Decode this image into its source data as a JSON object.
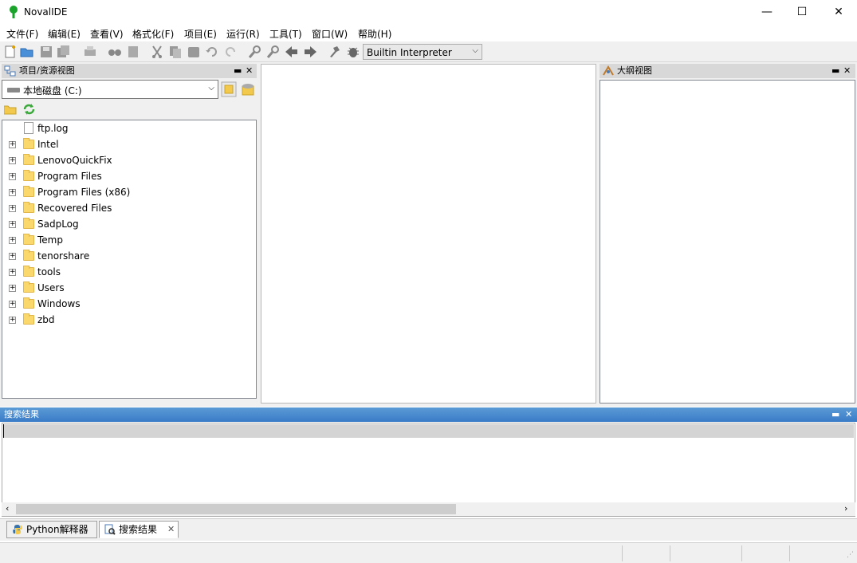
{
  "window": {
    "title": "NovalIDE",
    "minimize": "—",
    "maximize": "☐",
    "close": "✕"
  },
  "menu": [
    "文件(F)",
    "编辑(E)",
    "查看(V)",
    "格式化(F)",
    "项目(E)",
    "运行(R)",
    "工具(T)",
    "窗口(W)",
    "帮助(H)"
  ],
  "toolbar": {
    "interpreter_value": "Builtin Interpreter",
    "icons": [
      "new-file-icon",
      "open-folder-icon",
      "save-icon",
      "save-all-icon",
      "print-icon",
      "find-icon",
      "print-preview-icon",
      "cut-icon",
      "copy-icon",
      "paste-icon",
      "undo-icon",
      "redo-icon",
      "find-in-files-icon",
      "replace-icon",
      "back-arrow-icon",
      "forward-arrow-icon",
      "run-icon",
      "debug-bug-icon"
    ]
  },
  "left_pane": {
    "caption": "项目/资源视图",
    "drive": "本地磁盘 (C:)",
    "tree": [
      {
        "label": "ftp.log",
        "type": "file"
      },
      {
        "label": "Intel",
        "type": "folder"
      },
      {
        "label": "LenovoQuickFix",
        "type": "folder"
      },
      {
        "label": "Program Files",
        "type": "folder"
      },
      {
        "label": "Program Files (x86)",
        "type": "folder"
      },
      {
        "label": "Recovered Files",
        "type": "folder"
      },
      {
        "label": "SadpLog",
        "type": "folder"
      },
      {
        "label": "Temp",
        "type": "folder"
      },
      {
        "label": "tenorshare",
        "type": "folder"
      },
      {
        "label": "tools",
        "type": "folder"
      },
      {
        "label": "Users",
        "type": "folder"
      },
      {
        "label": "Windows",
        "type": "folder"
      },
      {
        "label": "zbd",
        "type": "folder"
      }
    ]
  },
  "right_pane": {
    "caption": "大纲视图"
  },
  "search_panel": {
    "caption": "搜索结果"
  },
  "bottom_tabs": [
    {
      "label": "Python解释器",
      "active": false
    },
    {
      "label": "搜索结果",
      "active": true
    }
  ],
  "colors": {
    "accent": "#3a7bc8",
    "folder": "#fbd86b",
    "caption_bg": "#d8d8d8"
  }
}
